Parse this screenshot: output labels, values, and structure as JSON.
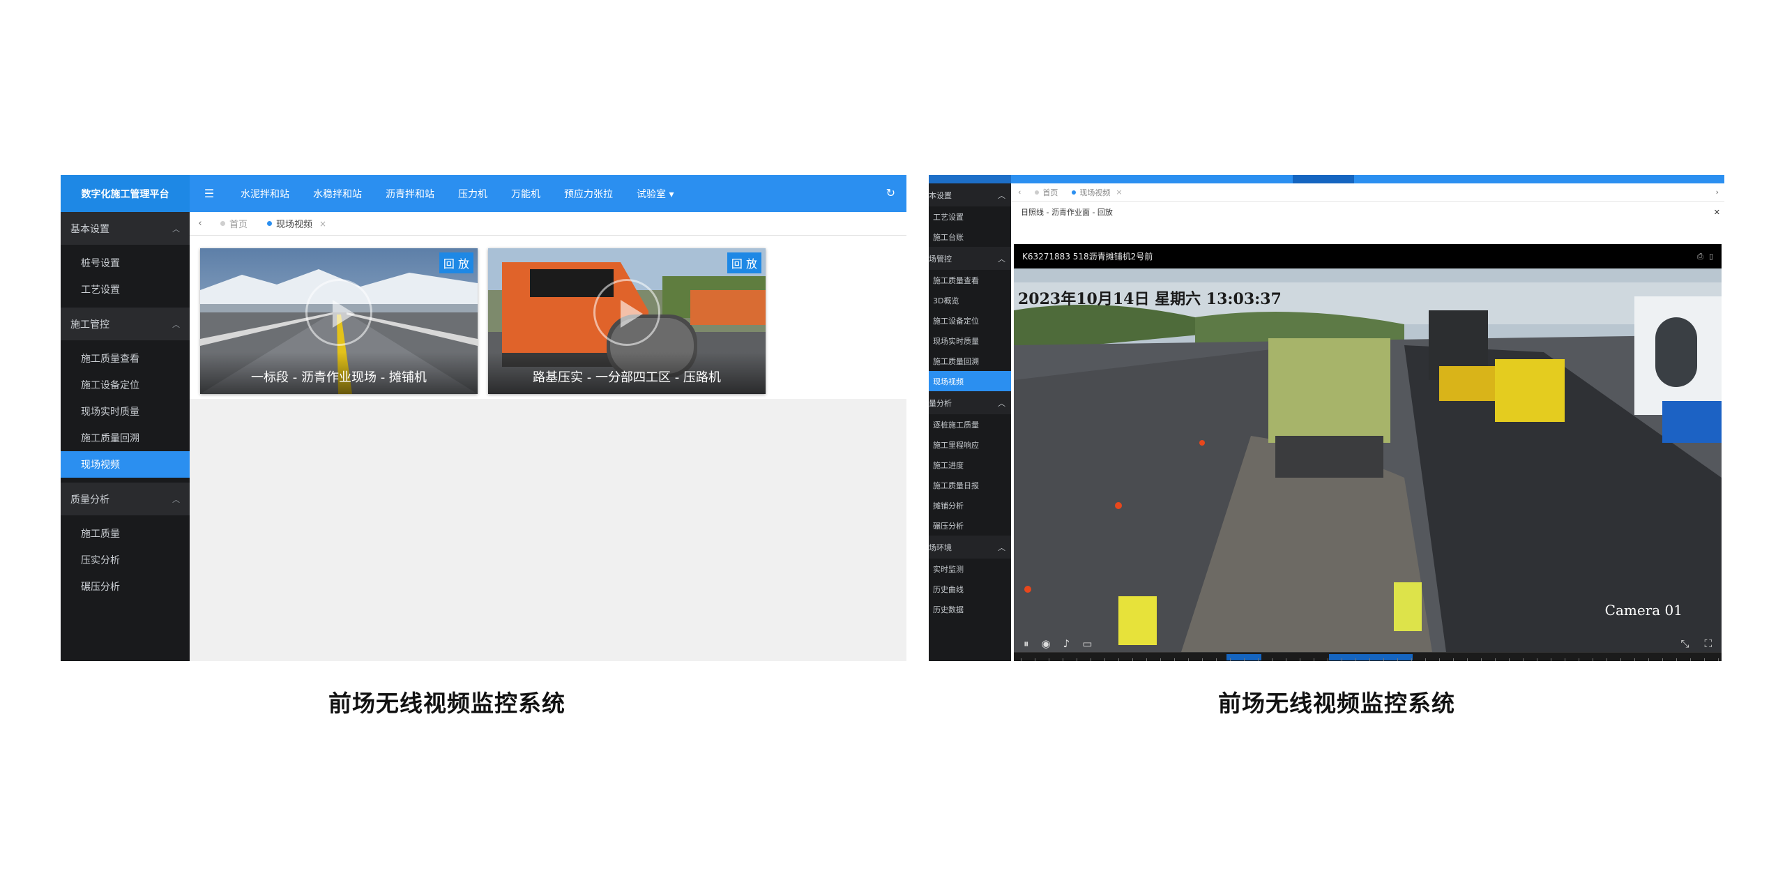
{
  "left": {
    "brand": "数字化施工管理平台",
    "menu_icon": "☰",
    "nav": [
      "水泥拌和站",
      "水稳拌和站",
      "沥青拌和站",
      "压力机",
      "万能机",
      "预应力张拉",
      "试验室"
    ],
    "nav_dropdown_caret": "▾",
    "refresh_icon": "↻",
    "tabs_back": "‹",
    "tabs": [
      {
        "label": "首页"
      },
      {
        "label": "现场视频",
        "close": "×"
      }
    ],
    "sidebar": [
      {
        "title": "基本设置",
        "items": [
          "桩号设置",
          "工艺设置"
        ]
      },
      {
        "title": "施工管控",
        "items": [
          "施工质量查看",
          "施工设备定位",
          "现场实时质量",
          "施工质量回溯",
          "现场视频"
        ]
      },
      {
        "title": "质量分析",
        "items": [
          "施工质量",
          "压实分析",
          "碾压分析"
        ]
      }
    ],
    "chevron": "︿",
    "videos": [
      {
        "replay": "回 放",
        "caption": "一标段 - 沥青作业现场 - 摊铺机"
      },
      {
        "replay": "回 放",
        "caption": "路基压实 - 一分部四工区 - 压路机"
      }
    ]
  },
  "right": {
    "tabs": [
      {
        "label": "首页"
      },
      {
        "label": "现场视频",
        "close": "×"
      }
    ],
    "prev": "‹",
    "next": "›",
    "dialog_title": "日照线 - 沥青作业面 - 回放",
    "dialog_close": "✕",
    "video_title": "K63271883   518沥青摊铺机2号前",
    "osd_time": "2023年10月14日  星期六  13:03:37",
    "camera": "Camera 01",
    "sidebar": [
      {
        "title": "本设置",
        "items": [
          "工艺设置",
          "施工台账"
        ]
      },
      {
        "title": "场管控",
        "items": [
          "施工质量查看",
          "3D概览",
          "施工设备定位",
          "现场实时质量",
          "施工质量回溯",
          "现场视频"
        ]
      },
      {
        "title": "量分析",
        "items": [
          "逐桩施工质量",
          "施工里程响应",
          "施工进度",
          "施工质量日报",
          "摊铺分析",
          "碾压分析"
        ]
      },
      {
        "title": "场环境",
        "items": [
          "实时监测",
          "历史曲线",
          "历史数据"
        ]
      }
    ],
    "active_item": "现场视频"
  },
  "captions": {
    "left": "前场无线视频监控系统",
    "right": "前场无线视频监控系统"
  }
}
